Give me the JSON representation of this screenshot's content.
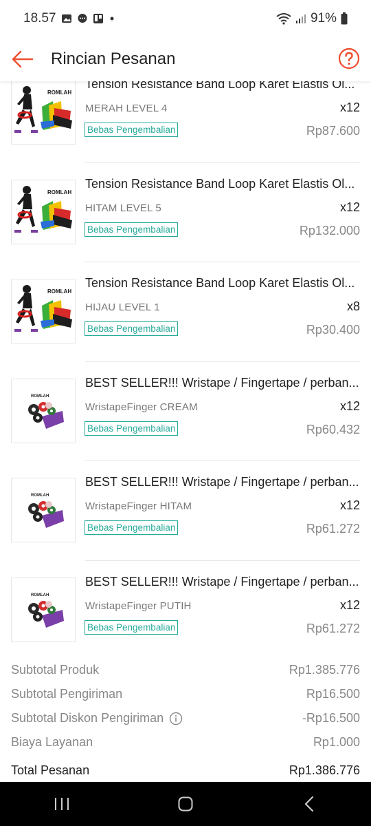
{
  "status_bar": {
    "time": "18.57",
    "battery": "91%"
  },
  "header": {
    "title": "Rincian Pesanan"
  },
  "products": [
    {
      "name": "Tension Resistance Band Loop Karet Elastis Ol...",
      "variant": "MERAH LEVEL 4",
      "qty": "x12",
      "badge": "Bebas Pengembalian",
      "price": "Rp87.600",
      "thumb_type": "band",
      "thumb_text": "ROMLAH"
    },
    {
      "name": "Tension Resistance Band Loop Karet Elastis Ol...",
      "variant": "HITAM LEVEL 5",
      "qty": "x12",
      "badge": "Bebas Pengembalian",
      "price": "Rp132.000",
      "thumb_type": "band",
      "thumb_text": "ROMLAH"
    },
    {
      "name": "Tension Resistance Band Loop Karet Elastis Ol...",
      "variant": "HIJAU LEVEL 1",
      "qty": "x8",
      "badge": "Bebas Pengembalian",
      "price": "Rp30.400",
      "thumb_type": "band",
      "thumb_text": "ROMLAH"
    },
    {
      "name": "BEST SELLER!!! Wristape / Fingertape / perban...",
      "variant": "WristapeFinger CREAM",
      "qty": "x12",
      "badge": "Bebas Pengembalian",
      "price": "Rp60.432",
      "thumb_type": "tape",
      "thumb_text": "ROMLAH"
    },
    {
      "name": "BEST SELLER!!! Wristape / Fingertape / perban...",
      "variant": "WristapeFinger HITAM",
      "qty": "x12",
      "badge": "Bebas Pengembalian",
      "price": "Rp61.272",
      "thumb_type": "tape",
      "thumb_text": "ROMLAH"
    },
    {
      "name": "BEST SELLER!!! Wristape / Fingertape / perban...",
      "variant": "WristapeFinger PUTIH",
      "qty": "x12",
      "badge": "Bebas Pengembalian",
      "price": "Rp61.272",
      "thumb_type": "tape",
      "thumb_text": "ROMLAH"
    }
  ],
  "summary": {
    "subtotal_produk_label": "Subtotal Produk",
    "subtotal_produk_value": "Rp1.385.776",
    "subtotal_pengiriman_label": "Subtotal Pengiriman",
    "subtotal_pengiriman_value": "Rp16.500",
    "diskon_label": "Subtotal Diskon Pengiriman",
    "diskon_value": "-Rp16.500",
    "biaya_label": "Biaya Layanan",
    "biaya_value": "Rp1.000",
    "total_label": "Total Pesanan",
    "total_value": "Rp1.386.776"
  },
  "colors": {
    "accent": "#ee4d2d",
    "badge": "#26aa99",
    "muted": "#888888"
  },
  "icons": {
    "back": "arrow-left-icon",
    "help": "question-circle-icon",
    "info": "info-circle-icon"
  }
}
